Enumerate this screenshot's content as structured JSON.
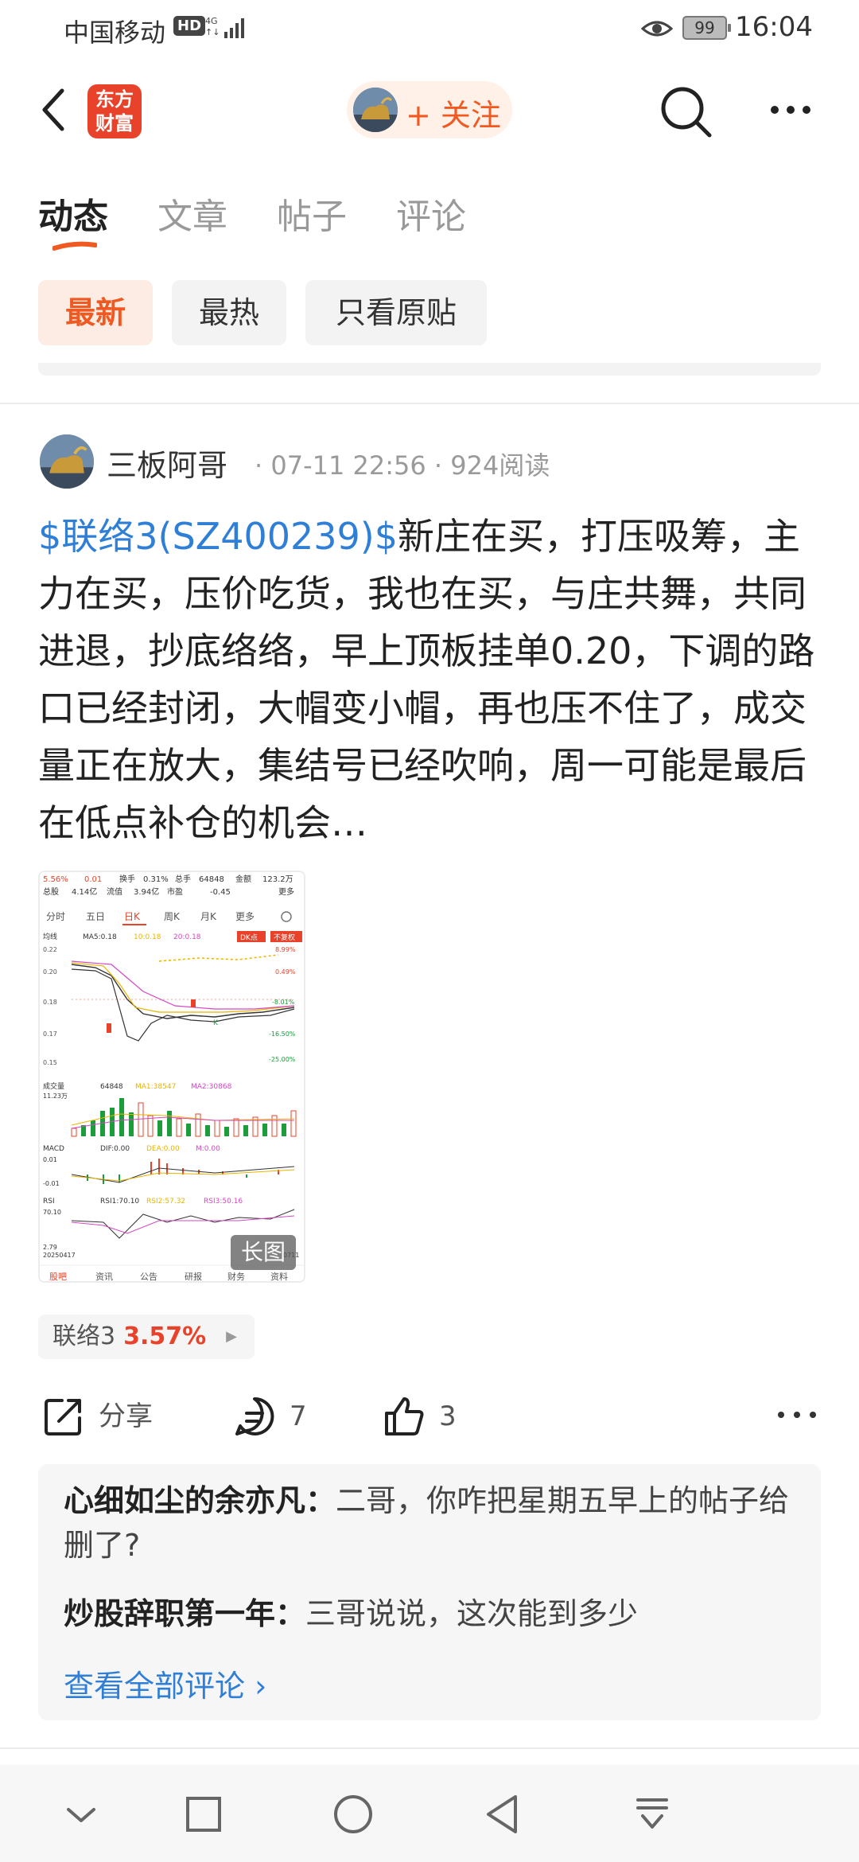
{
  "status_bar": {
    "carrier": "中国移动",
    "hd": "HD",
    "network": "4G",
    "battery": "99",
    "time": "16:04"
  },
  "header": {
    "logo_line1": "东方",
    "logo_line2": "财富",
    "follow_label": "+ 关注"
  },
  "tabs": [
    {
      "label": "动态",
      "active": true
    },
    {
      "label": "文章",
      "active": false
    },
    {
      "label": "帖子",
      "active": false
    },
    {
      "label": "评论",
      "active": false
    }
  ],
  "filters": [
    {
      "label": "最新",
      "active": true
    },
    {
      "label": "最热",
      "active": false
    },
    {
      "label": "只看原贴",
      "active": false
    }
  ],
  "post": {
    "author": "三板阿哥",
    "meta": "· 07-11 22:56 · 924阅读",
    "stock_tag": "$联络3(SZ400239)$",
    "body": "新庄在买，打压吸筹，主力在买，压价吃货，我也在买，与庄共舞，共同进退，抄底络络，早上顶板挂单0.20，下调的路口已经封闭，大帽变小帽，再也压不住了，成交量正在放大，集结号已经吹响，周一可能是最后在低点补仓的机会…",
    "image_badge": "长图",
    "stock_chip": {
      "name": "联络3",
      "change": "3.57%"
    },
    "actions": {
      "share": "分享",
      "comments": "7",
      "likes": "3"
    }
  },
  "thumbnail": {
    "top_row": [
      "5.56%",
      "0.01",
      "换手",
      "0.31%",
      "总手",
      "64848",
      "金额",
      "123.2万"
    ],
    "second_row": [
      "总股",
      "4.14亿",
      "流值",
      "3.94亿",
      "市盈",
      "-0.45",
      "更多"
    ],
    "periods": [
      "分时",
      "五日",
      "日K",
      "周K",
      "月K",
      "更多"
    ],
    "ma_label": "均线",
    "ma_values": [
      "MA5:0.18",
      "10:0.18",
      "20:0.18"
    ],
    "dk_label": "DK点",
    "fq_label": "不复权",
    "y_labels": [
      "0.22",
      "0.20",
      "0.18",
      "0.17",
      "0.15"
    ],
    "pct_labels": [
      "8.99%",
      "0.49%",
      "-8.01%",
      "-16.50%",
      "-25.00%"
    ],
    "vol_label": "成交量",
    "vol_values": [
      "64848",
      "MA1:38547",
      "MA2:30868"
    ],
    "vol_max": "11.23万",
    "macd_label": "MACD",
    "macd_values": [
      "DIF:0.00",
      "DEA:0.00",
      "M:0.00"
    ],
    "macd_levels": [
      "0.01",
      "-0.01"
    ],
    "rsi_label": "RSI",
    "rsi_values": [
      "RSI1:70.10",
      "RSI2:57.32",
      "RSI3:50.16"
    ],
    "rsi_levels": [
      "70.10",
      "2.79"
    ],
    "start_date": "20250417",
    "end_date": "0711",
    "bottom_tabs": [
      "股吧",
      "资讯",
      "公告",
      "研报",
      "财务",
      "资料"
    ]
  },
  "comments": [
    {
      "name": "心细如尘的余亦凡：",
      "text": "二哥，你咋把星期五早上的帖子给删了?"
    },
    {
      "name": "炒股辞职第一年：",
      "text": "三哥说说，这次能到多少"
    }
  ],
  "view_all": "查看全部评论 ›",
  "colors": {
    "accent": "#f05a22",
    "link": "#2f7fd6",
    "brand": "#e8432a"
  }
}
